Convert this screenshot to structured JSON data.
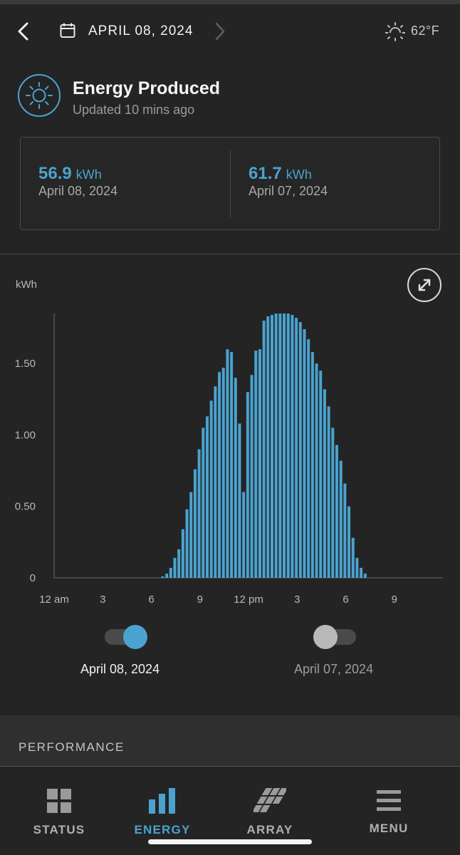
{
  "header": {
    "date": "APRIL 08, 2024",
    "temperature": "62°F",
    "icons": {
      "back": "chevron-left-icon",
      "calendar": "calendar-icon",
      "next": "chevron-right-icon",
      "weather": "sun-icon"
    }
  },
  "energy": {
    "title": "Energy Produced",
    "updated": "Updated 10 mins ago",
    "icon": "sun-icon",
    "accent_color": "#4aa3cf"
  },
  "summary": [
    {
      "value": "56.9",
      "unit": "kWh",
      "date": "April 08, 2024"
    },
    {
      "value": "61.7",
      "unit": "kWh",
      "date": "April 07, 2024"
    }
  ],
  "chart_data": {
    "type": "bar",
    "ylabel": "kWh",
    "ylim": [
      0,
      1.85
    ],
    "yticks": [
      0,
      0.5,
      1.0,
      1.5
    ],
    "ytick_labels": [
      "0",
      "0.50",
      "1.00",
      "1.50"
    ],
    "xtick_labels": [
      "12 am",
      "3",
      "6",
      "9",
      "12 pm",
      "3",
      "6",
      "9"
    ],
    "bar_color": "#4aa3cf",
    "grid": false,
    "series": [
      {
        "name": "April 08, 2024",
        "values": [
          0.01,
          0.03,
          0.07,
          0.14,
          0.2,
          0.34,
          0.48,
          0.6,
          0.76,
          0.9,
          1.05,
          1.13,
          1.24,
          1.34,
          1.44,
          1.47,
          1.6,
          1.58,
          1.4,
          1.08,
          0.6,
          1.3,
          1.42,
          1.59,
          1.6,
          1.8,
          1.83,
          1.84,
          1.85,
          1.85,
          1.85,
          1.85,
          1.84,
          1.82,
          1.79,
          1.74,
          1.67,
          1.58,
          1.5,
          1.45,
          1.32,
          1.2,
          1.05,
          0.93,
          0.82,
          0.66,
          0.5,
          0.28,
          0.14,
          0.07,
          0.03
        ]
      }
    ],
    "bar_start_hour": 6.7,
    "bar_interval_hours": 0.25
  },
  "toggles": [
    {
      "label": "April 08, 2024",
      "on": true,
      "knob_color": "#4aa3cf",
      "label_color": "#f0f0f0"
    },
    {
      "label": "April 07, 2024",
      "on": false,
      "knob_color": "#b9b9b9",
      "label_color": "#9c9c9c"
    }
  ],
  "performance": {
    "title": "PERFORMANCE"
  },
  "tabs": [
    {
      "label": "STATUS",
      "icon": "grid-icon",
      "active": false
    },
    {
      "label": "ENERGY",
      "icon": "bar-chart-icon",
      "active": true
    },
    {
      "label": "ARRAY",
      "icon": "solar-array-icon",
      "active": false
    },
    {
      "label": "MENU",
      "icon": "menu-icon",
      "active": false
    }
  ]
}
